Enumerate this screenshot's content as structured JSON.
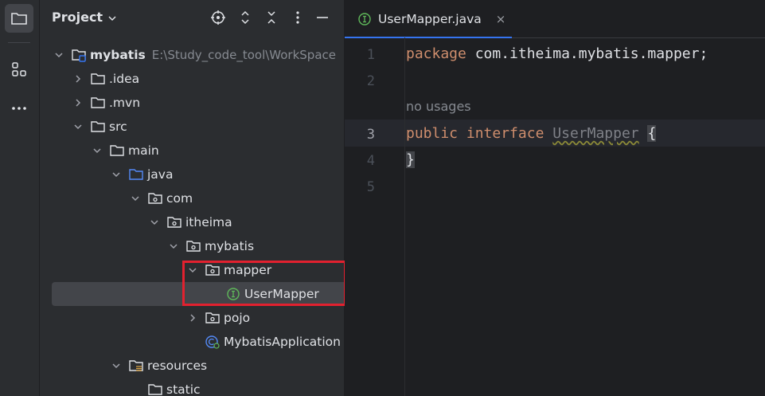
{
  "project_panel": {
    "title": "Project",
    "tree": [
      {
        "label": "mybatis",
        "path": "E:\\Study_code_tool\\WorkSpace",
        "expanded": true,
        "icon": "module-folder-icon"
      },
      {
        "label": ".idea",
        "expanded": false,
        "icon": "folder-icon"
      },
      {
        "label": ".mvn",
        "expanded": false,
        "icon": "folder-icon"
      },
      {
        "label": "src",
        "expanded": true,
        "icon": "folder-icon"
      },
      {
        "label": "main",
        "expanded": true,
        "icon": "folder-icon"
      },
      {
        "label": "java",
        "expanded": true,
        "icon": "source-folder-icon"
      },
      {
        "label": "com",
        "expanded": true,
        "icon": "package-icon"
      },
      {
        "label": "itheima",
        "expanded": true,
        "icon": "package-icon"
      },
      {
        "label": "mybatis",
        "expanded": true,
        "icon": "package-icon"
      },
      {
        "label": "mapper",
        "expanded": true,
        "icon": "package-icon"
      },
      {
        "label": "UserMapper",
        "icon": "interface-icon",
        "selected": true
      },
      {
        "label": "pojo",
        "expanded": false,
        "icon": "package-icon"
      },
      {
        "label": "MybatisApplication",
        "icon": "spring-class-icon"
      },
      {
        "label": "resources",
        "expanded": true,
        "icon": "resources-folder-icon"
      },
      {
        "label": "static",
        "icon": "folder-icon"
      }
    ]
  },
  "editor": {
    "tab": {
      "label": "UserMapper.java",
      "close": "×"
    },
    "line_numbers": [
      "1",
      "2",
      "3",
      "4",
      "5"
    ],
    "current_line": "3",
    "code": {
      "line1_keyword": "package",
      "line1_rest": " com.itheima.mybatis.mapper;",
      "usage_hint": "no usages",
      "line3_kw1": "public",
      "line3_kw2": "interface",
      "line3_class": "UserMapper",
      "line3_brace": "{",
      "line4_brace": "}"
    }
  },
  "colors": {
    "accent": "#3574f0",
    "keyword": "#cf8e6d",
    "highlight_box": "#e2212f",
    "interface_icon": "#5fb85a"
  }
}
